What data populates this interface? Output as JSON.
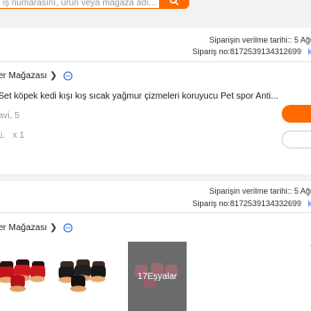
{
  "search": {
    "placeholder": "iş numarasını, ürün veya mağaza adı..."
  },
  "orders": [
    {
      "date_label": "Siparişin verilme tarihi:: 5 Ağu",
      "order_no_label": "Sipariş no:8172539134312699",
      "copy_link": "k",
      "store_name": "er Mağazası",
      "product_title": "Set köpek kedi kışı kış sıcak yağmur çizmeleri koruyucu Pet spor Anti...",
      "variant": "avi, 5",
      "quantity": "x 1"
    },
    {
      "date_label": "Siparişin verilme tarihi:: 5 Ağu",
      "order_no_label": "Sipariş no:8172539134332699",
      "copy_link": "k",
      "store_name": "er Mağazası",
      "more_items_label": "17Eşyalar"
    }
  ],
  "colors": {
    "accent": "#ff6a00",
    "link": "#2f6cd6",
    "background": "#f2f2f2"
  }
}
